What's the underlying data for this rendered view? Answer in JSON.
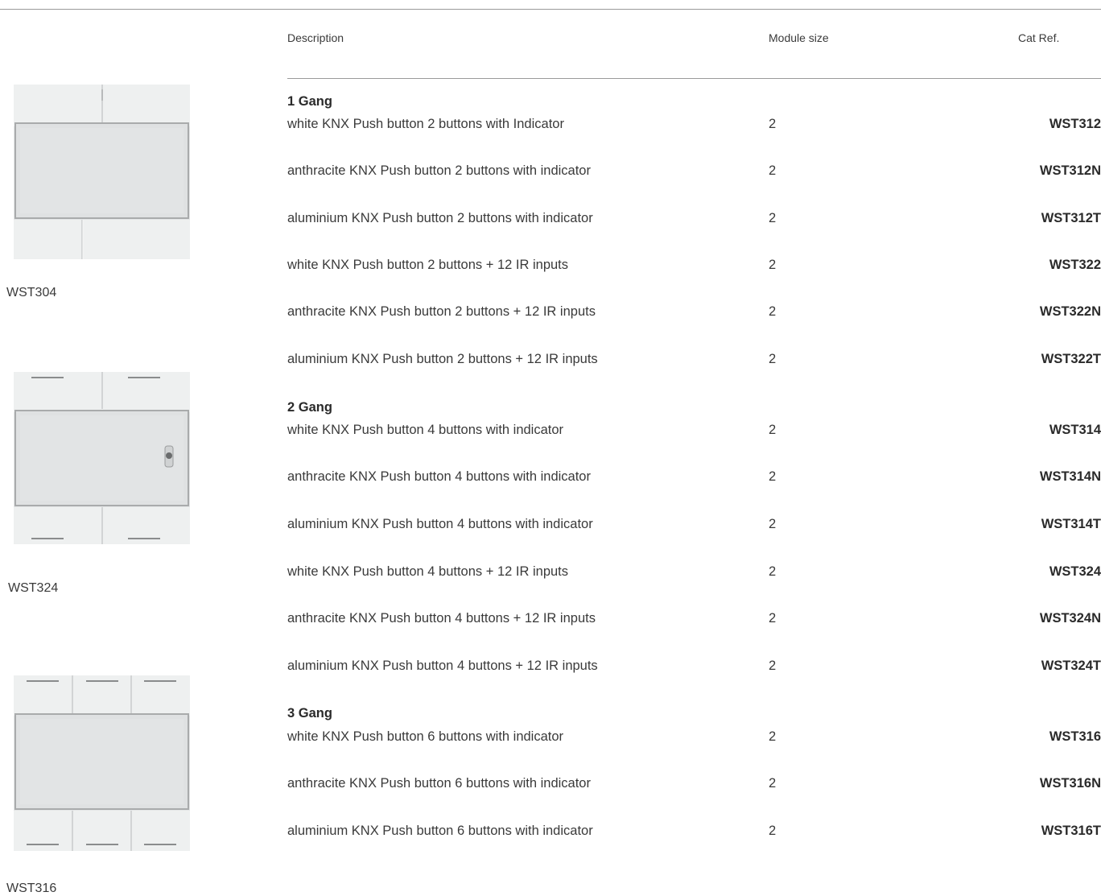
{
  "header": {
    "description": "Description",
    "module_size": "Module size",
    "cat_ref": "Cat Ref."
  },
  "groups": [
    {
      "title": "1 Gang",
      "rows": [
        {
          "description": "white KNX Push button 2 buttons with Indicator",
          "module": "2",
          "cat": "WST312"
        },
        {
          "description": "anthracite KNX Push button 2 buttons with indicator",
          "module": "2",
          "cat": "WST312N"
        },
        {
          "description": "aluminium KNX Push button 2 buttons with indicator",
          "module": "2",
          "cat": "WST312T"
        },
        {
          "description": "white KNX Push button 2 buttons + 12 IR inputs",
          "module": "2",
          "cat": "WST322"
        },
        {
          "description": "anthracite KNX Push button 2 buttons + 12 IR inputs",
          "module": "2",
          "cat": "WST322N"
        },
        {
          "description": "aluminium KNX Push button 2 buttons + 12 IR inputs",
          "module": "2",
          "cat": "WST322T"
        }
      ]
    },
    {
      "title": "2 Gang",
      "rows": [
        {
          "description": "white KNX Push button 4 buttons with indicator",
          "module": "2",
          "cat": "WST314"
        },
        {
          "description": "anthracite KNX Push button 4 buttons with indicator",
          "module": "2",
          "cat": "WST314N"
        },
        {
          "description": "aluminium KNX Push button 4 buttons with indicator",
          "module": "2",
          "cat": "WST314T"
        },
        {
          "description": "white KNX Push button 4 buttons + 12 IR inputs",
          "module": "2",
          "cat": "WST324"
        },
        {
          "description": "anthracite KNX Push button 4 buttons + 12 IR inputs",
          "module": "2",
          "cat": "WST324N"
        },
        {
          "description": "aluminium KNX Push button 4 buttons + 12 IR inputs",
          "module": "2",
          "cat": "WST324T"
        }
      ]
    },
    {
      "title": "3 Gang",
      "rows": [
        {
          "description": "white KNX Push button 6 buttons with indicator",
          "module": "2",
          "cat": "WST316"
        },
        {
          "description": "anthracite KNX Push button 6 buttons with indicator",
          "module": "2",
          "cat": "WST316N"
        },
        {
          "description": "aluminium KNX Push button 6 buttons with indicator",
          "module": "2",
          "cat": "WST316T"
        }
      ]
    }
  ],
  "images": [
    {
      "label": "WST304",
      "icon": "push-button-2-icon"
    },
    {
      "label": "WST324",
      "icon": "push-button-4-ir-icon"
    },
    {
      "label": "WST316",
      "icon": "push-button-6-icon"
    }
  ]
}
